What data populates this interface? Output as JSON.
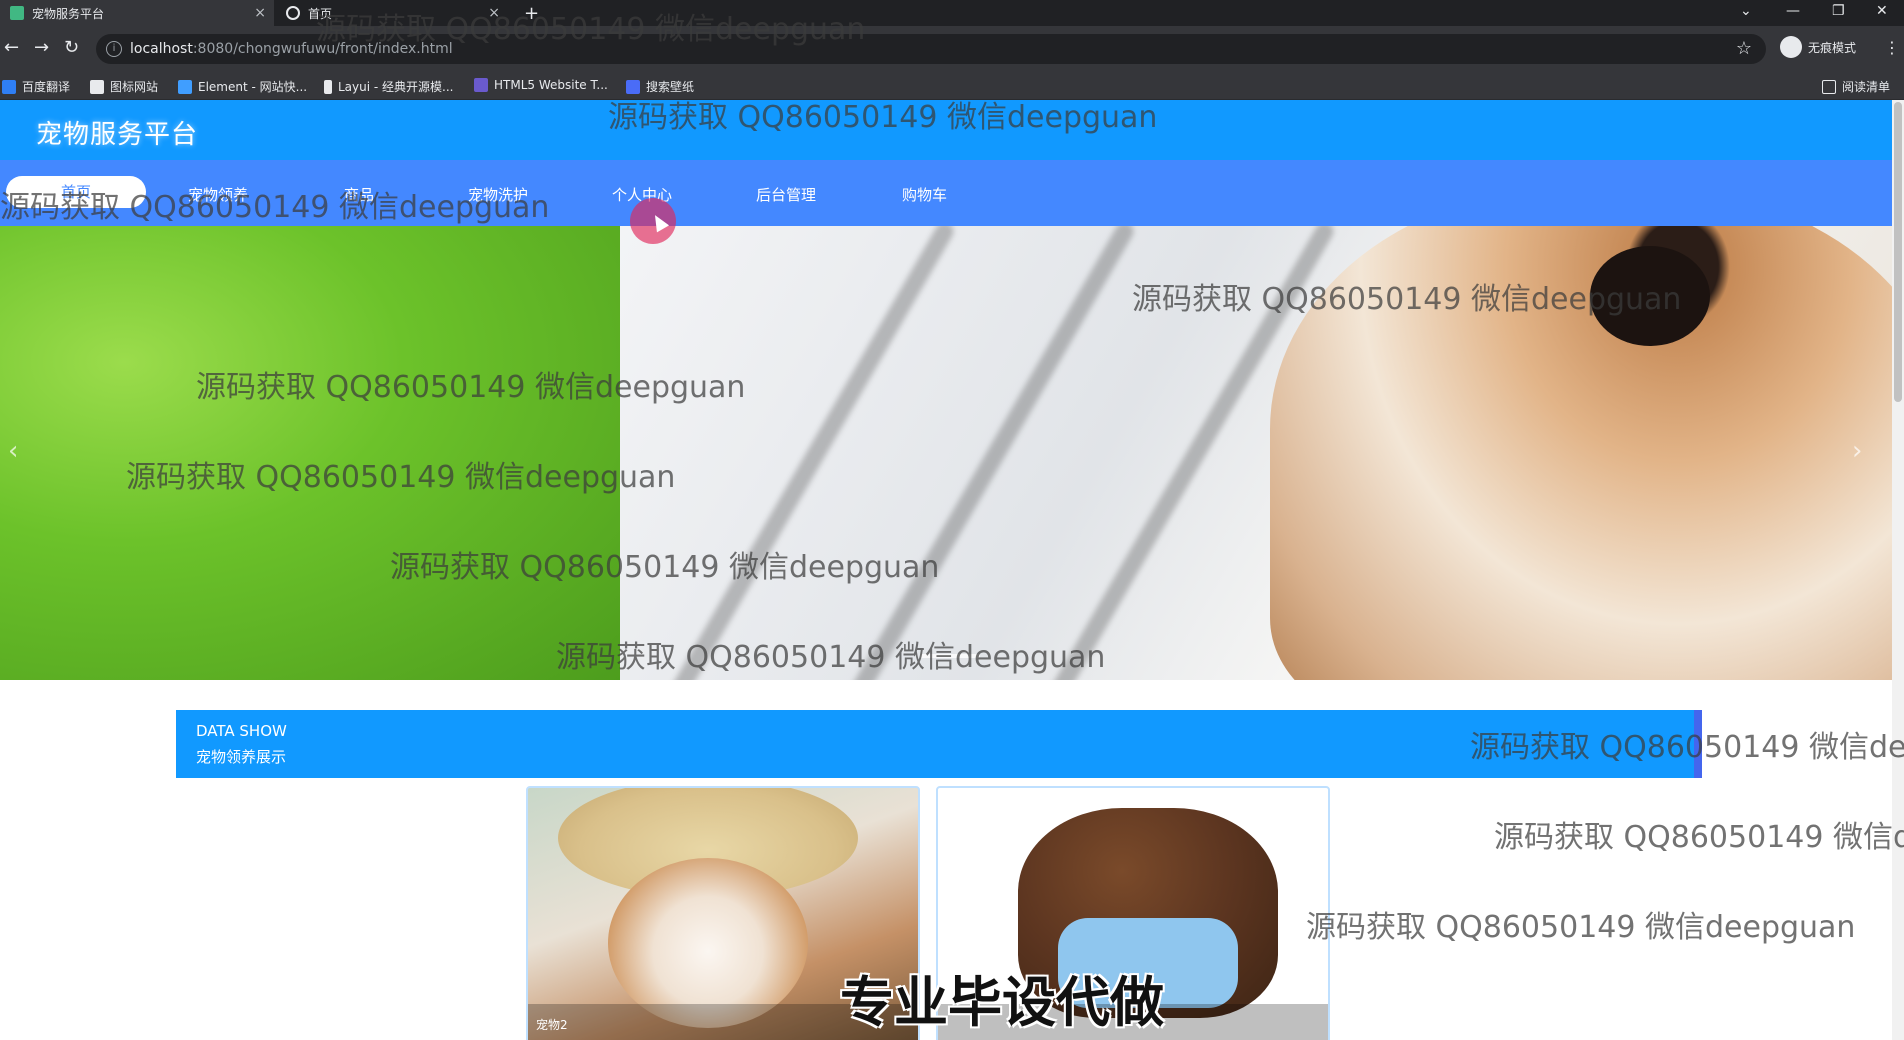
{
  "browser": {
    "tabs": [
      {
        "title": "宠物服务平台",
        "active": true
      },
      {
        "title": "首页",
        "active": false
      }
    ],
    "new_tab": "+",
    "url_host": "localhost",
    "url_path": ":8080/chongwufuwu/front/index.html",
    "profile_label": "无痕模式",
    "bookmarks": [
      "百度翻译",
      "图标网站",
      "Element - 网站快...",
      "Layui - 经典开源模...",
      "HTML5 Website T...",
      "搜索壁纸"
    ],
    "reading_list": "阅读清单"
  },
  "site": {
    "title": "宠物服务平台",
    "nav": [
      "首页",
      "宠物领养",
      "商品",
      "宠物洗护",
      "个人中心",
      "后台管理",
      "购物车"
    ],
    "section": {
      "en": "DATA SHOW",
      "cn": "宠物领养展示"
    },
    "cards": [
      {
        "label": "宠物2"
      },
      {
        "label": ""
      }
    ]
  },
  "overlay": {
    "watermark": "源码获取 QQ86050149 微信deepguan",
    "caption": "专业毕设代做"
  },
  "colors": {
    "header": "#1199ff",
    "nav": "#4488ff",
    "section_bar": "#1199ff"
  }
}
